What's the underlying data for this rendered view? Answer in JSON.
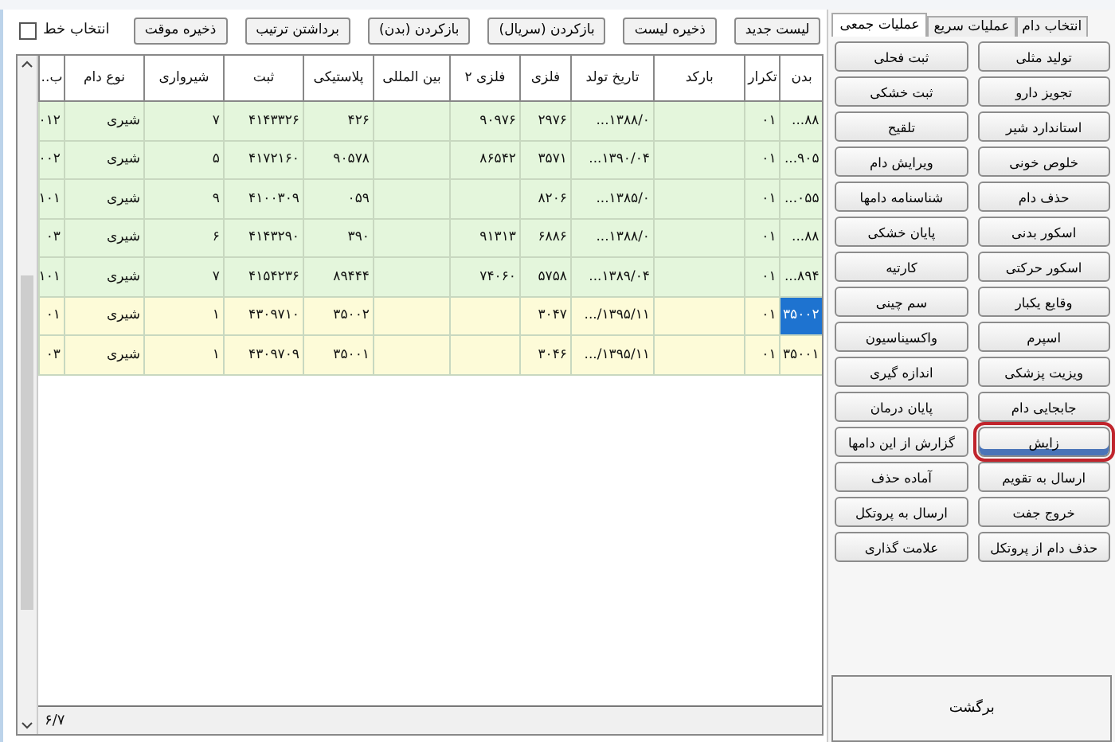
{
  "toolbar": {
    "buttons": [
      "لیست جدید",
      "ذخیره لیست",
      "بازکردن (سریال)",
      "بازکردن (بدن)",
      "برداشتن ترتیب",
      "ذخیره موقت"
    ],
    "row_select": {
      "label": "انتخاب خط",
      "checked": false
    }
  },
  "table": {
    "columns": [
      "بدن",
      "تکرار",
      "بارکد",
      "تاریخ تولد",
      "فلزی",
      "فلزی ۲",
      "بین المللی",
      "پلاستیکی",
      "ثبت",
      "شیرواری",
      "نوع دام",
      "ب.."
    ],
    "rows": [
      {
        "color": "#e4f6dc",
        "selected": false,
        "cells": [
          "...۸۸",
          "۰۱",
          null,
          "...۱۳۸۸/۰",
          "۲۹۷۶",
          "۹۰۹۷۶",
          null,
          "۴۲۶",
          "۴۱۴۳۳۲۶",
          "۷",
          "شیری",
          "۰۱۲"
        ]
      },
      {
        "color": "#e4f6dc",
        "selected": false,
        "cells": [
          "...۹۰۵",
          "۰۱",
          null,
          "...۱۳۹۰/۰۴",
          "۳۵۷۱",
          "۸۶۵۴۲",
          null,
          "۹۰۵۷۸",
          "۴۱۷۲۱۶۰",
          "۵",
          "شیری",
          "۰۰۲"
        ]
      },
      {
        "color": "#e4f6dc",
        "selected": false,
        "cells": [
          "...۰۵۵",
          "۰۱",
          null,
          "...۱۳۸۵/۰",
          "۸۲۰۶",
          null,
          null,
          "۰۵۹",
          "۴۱۰۰۳۰۹",
          "۹",
          "شیری",
          "۱۰۱"
        ]
      },
      {
        "color": "#e4f6dc",
        "selected": false,
        "cells": [
          "...۸۸",
          "۰۱",
          null,
          "...۱۳۸۸/۰",
          "۶۸۸۶",
          "۹۱۳۱۳",
          null,
          "۳۹۰",
          "۴۱۴۳۲۹۰",
          "۶",
          "شیری",
          "۰۳"
        ]
      },
      {
        "color": "#e4f6dc",
        "selected": false,
        "cells": [
          "...۸۹۴",
          "۰۱",
          null,
          "...۱۳۸۹/۰۴",
          "۵۷۵۸",
          "۷۴۰۶۰",
          null,
          "۸۹۴۴۴",
          "۴۱۵۴۲۳۶",
          "۷",
          "شیری",
          "۱۰۱"
        ]
      },
      {
        "color": "#fdfbd8",
        "selected": true,
        "cells": [
          "۳۵۰۰۲",
          "۰۱",
          null,
          ".../۱۳۹۵/۱۱",
          "۳۰۴۷",
          null,
          null,
          "۳۵۰۰۲",
          "۴۳۰۹۷۱۰",
          "۱",
          "شیری",
          "۰۱"
        ]
      },
      {
        "color": "#fdfbd8",
        "selected": false,
        "cells": [
          "۳۵۰۰۱",
          "۰۱",
          null,
          ".../۱۳۹۵/۱۱",
          "۳۰۴۶",
          null,
          null,
          "۳۵۰۰۱",
          "۴۳۰۹۷۰۹",
          "۱",
          "شیری",
          "۰۳"
        ]
      }
    ]
  },
  "status_bar": {
    "record": "۶/۷"
  },
  "side_panel": {
    "tabs": [
      {
        "label": "انتخاب دام",
        "selected": false
      },
      {
        "label": "عملیات سریع",
        "selected": false
      },
      {
        "label": "عملیات جمعی",
        "selected": true
      }
    ],
    "buttons": [
      {
        "label": "تولید مثلی",
        "focused": false
      },
      {
        "label": "ثبت فحلی",
        "focused": false
      },
      {
        "label": "تجویز دارو",
        "focused": false
      },
      {
        "label": "ثبت خشکی",
        "focused": false
      },
      {
        "label": "استاندارد شیر",
        "focused": false
      },
      {
        "label": "تلقیح",
        "focused": false
      },
      {
        "label": "خلوص خونی",
        "focused": false
      },
      {
        "label": "ویرایش دام",
        "focused": false
      },
      {
        "label": "حذف دام",
        "focused": false
      },
      {
        "label": "شناسنامه دامها",
        "focused": false
      },
      {
        "label": "اسکور بدنی",
        "focused": false
      },
      {
        "label": "پایان خشکی",
        "focused": false
      },
      {
        "label": "اسکور حرکتی",
        "focused": false
      },
      {
        "label": "کارتیه",
        "focused": false
      },
      {
        "label": "وقایع یکبار",
        "focused": false
      },
      {
        "label": "سم چینی",
        "focused": false
      },
      {
        "label": "اسپرم",
        "focused": false
      },
      {
        "label": "واکسیناسیون",
        "focused": false
      },
      {
        "label": "ویزیت پزشکی",
        "focused": false
      },
      {
        "label": "اندازه گیری",
        "focused": false
      },
      {
        "label": "جابجایی دام",
        "focused": false
      },
      {
        "label": "پایان درمان",
        "focused": false
      },
      {
        "label": "زایش",
        "focused": true
      },
      {
        "label": "گزارش از این دامها",
        "focused": false
      },
      {
        "label": "ارسال به تقویم",
        "focused": false
      },
      {
        "label": "آماده حذف",
        "focused": false
      },
      {
        "label": "خروج جفت",
        "focused": false
      },
      {
        "label": "ارسال به پروتکل",
        "focused": false
      },
      {
        "label": "حذف دام از پروتکل",
        "focused": false
      },
      {
        "label": "علامت گذاری",
        "focused": false
      }
    ],
    "back_button": "برگشت"
  }
}
